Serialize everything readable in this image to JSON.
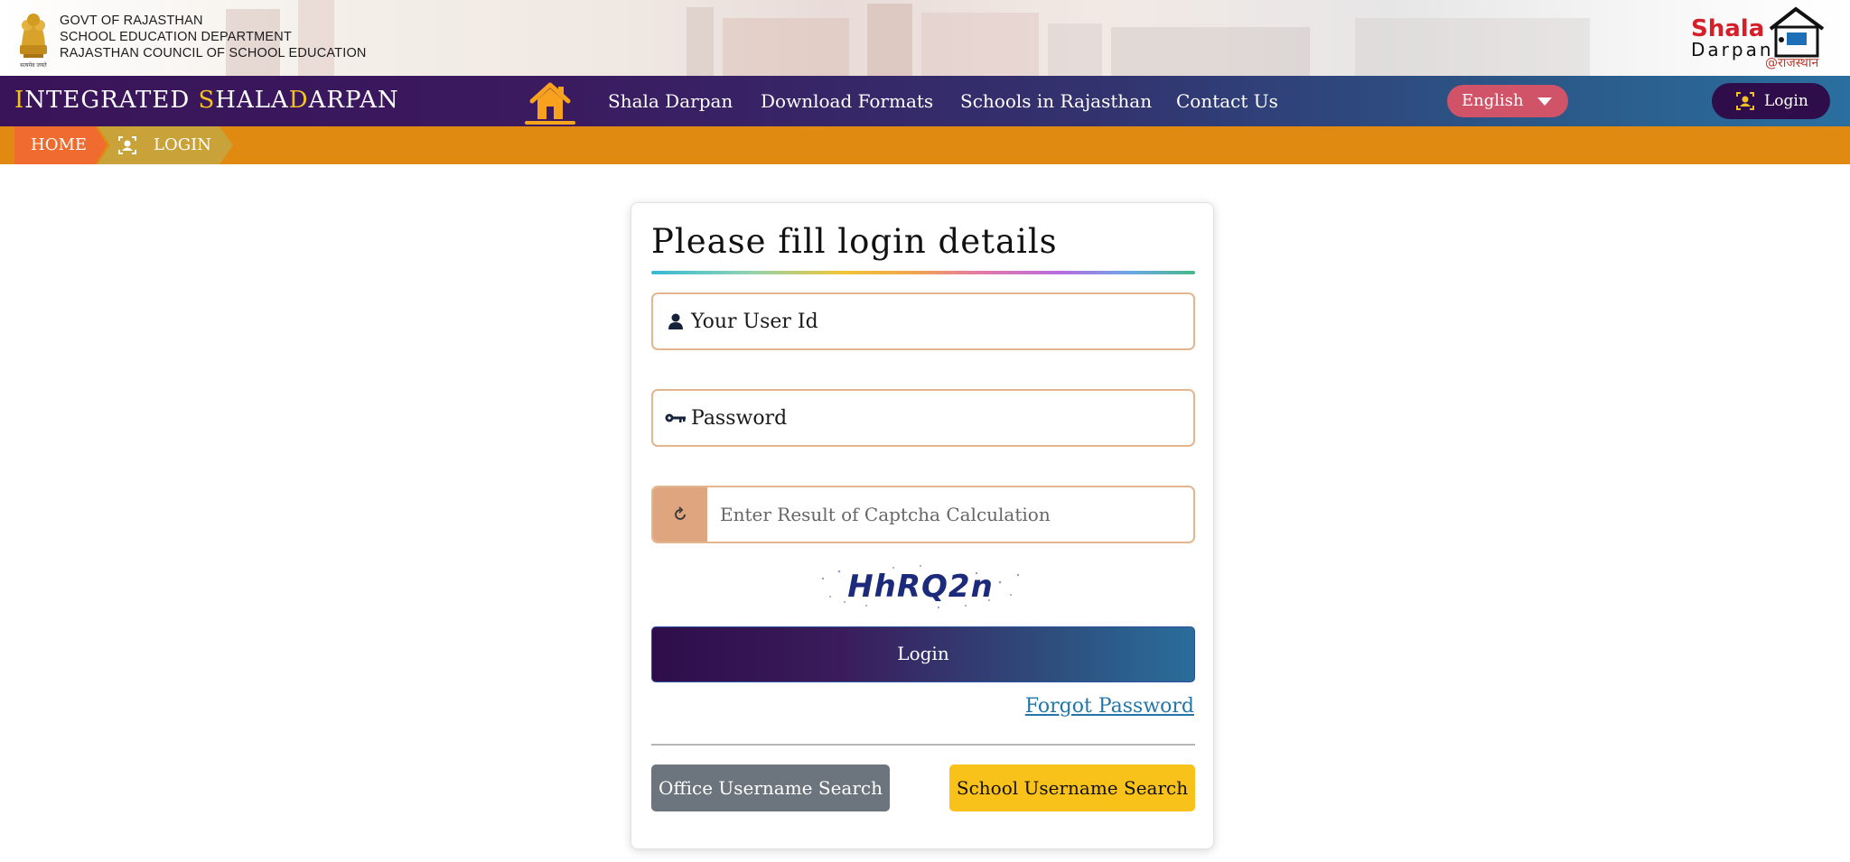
{
  "header": {
    "govt_lines": [
      "GOVT OF RAJASTHAN",
      "SCHOOL EDUCATION DEPARTMENT",
      "RAJASTHAN COUNCIL OF SCHOOL EDUCATION"
    ],
    "emblem_caption": "सत्यमेव जयते",
    "logo": {
      "word1": "Shala",
      "word2": "Darpan",
      "tagline": "@राजस्थान"
    }
  },
  "navbar": {
    "brand_parts": [
      {
        "text": "I",
        "highlight": true
      },
      {
        "text": "NTEGRATED ",
        "highlight": false
      },
      {
        "text": "S",
        "highlight": true
      },
      {
        "text": "HALA",
        "highlight": false
      },
      {
        "text": "D",
        "highlight": true
      },
      {
        "text": "ARPAN",
        "highlight": false
      }
    ],
    "home_icon": "home-icon",
    "items": [
      "Shala Darpan",
      "Download Formats",
      "Schools in Rajasthan",
      "Contact Us"
    ],
    "language": "English",
    "login_label": "Login"
  },
  "breadcrumb": {
    "home": "HOME",
    "current": "LOGIN"
  },
  "form": {
    "title": "Please fill login details",
    "userid_placeholder": "Your User Id",
    "password_placeholder": "Password",
    "captcha_placeholder": "Enter Result of Captcha Calculation",
    "captcha_text": "HhRQ2n",
    "login_button": "Login",
    "forgot_password": "Forgot Password",
    "office_search": "Office Username Search",
    "school_search": "School Username Search"
  },
  "colors": {
    "navbar_start": "#3a1458",
    "navbar_end": "#2a6fa0",
    "breadcrumb_bar": "#e08a12",
    "accent_yellow": "#f4c322",
    "language_pill": "#d05367",
    "field_border": "#e3b68f",
    "office_button": "#6c757d",
    "school_button": "#f8c21a",
    "link": "#2277a8"
  }
}
